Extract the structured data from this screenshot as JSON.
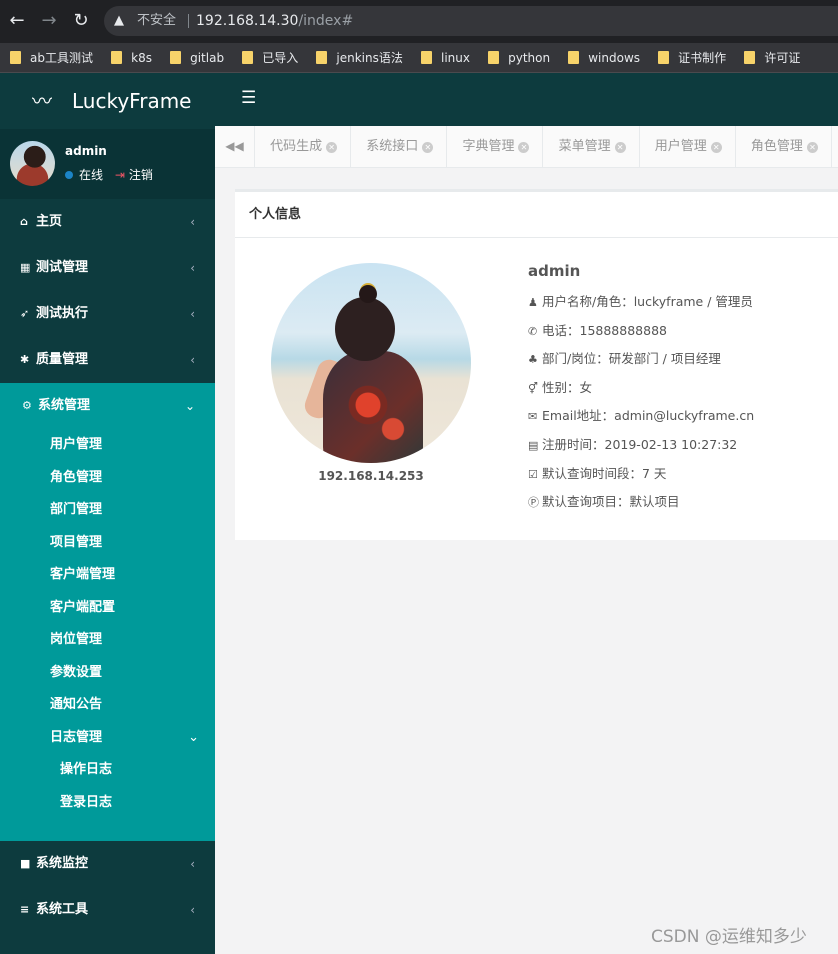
{
  "browser": {
    "security_label": "不安全",
    "url_host": "192.168.14.30",
    "url_path": "/index#",
    "bookmarks": [
      "ab工具测试",
      "k8s",
      "gitlab",
      "已导入",
      "jenkins语法",
      "linux",
      "python",
      "windows",
      "证书制作",
      "许可证"
    ]
  },
  "app": {
    "brand": "LuckyFrame",
    "user": {
      "name": "admin",
      "status": "在线",
      "logout": "注销"
    }
  },
  "sidebar": {
    "items": [
      {
        "label": "主页",
        "icon": "home-icon"
      },
      {
        "label": "测试管理",
        "icon": "grid-icon"
      },
      {
        "label": "测试执行",
        "icon": "rocket-icon"
      },
      {
        "label": "质量管理",
        "icon": "bug-icon"
      }
    ],
    "system": {
      "label": "系统管理",
      "icon": "gear-icon",
      "children": [
        "用户管理",
        "角色管理",
        "部门管理",
        "项目管理",
        "客户端管理",
        "客户端配置",
        "岗位管理",
        "参数设置",
        "通知公告"
      ],
      "log": {
        "label": "日志管理",
        "children": [
          "操作日志",
          "登录日志"
        ]
      }
    },
    "bottom": [
      {
        "label": "系统监控",
        "icon": "video-icon"
      },
      {
        "label": "系统工具",
        "icon": "list-icon"
      }
    ]
  },
  "tabs": [
    "代码生成",
    "系统接口",
    "字典管理",
    "菜单管理",
    "用户管理",
    "角色管理"
  ],
  "profile": {
    "panel_title": "个人信息",
    "ip": "192.168.14.253",
    "name": "admin",
    "rows": [
      {
        "icon": "user-icon",
        "text": "用户名称/角色：luckyframe / 管理员"
      },
      {
        "icon": "phone-icon",
        "text": "电话：15888888888"
      },
      {
        "icon": "group-icon",
        "text": "部门/岗位：研发部门 / 项目经理"
      },
      {
        "icon": "gender-icon",
        "text": "性别：女"
      },
      {
        "icon": "envelope-icon",
        "text": "Email地址：admin@luckyframe.cn"
      },
      {
        "icon": "calendar-icon",
        "text": "注册时间：2019-02-13 10:27:32"
      },
      {
        "icon": "calendar-check-icon",
        "text": "默认查询时间段：7 天"
      },
      {
        "icon": "project-icon",
        "text": "默认查询项目：默认项目"
      }
    ]
  },
  "watermark": "CSDN @运维知多少"
}
